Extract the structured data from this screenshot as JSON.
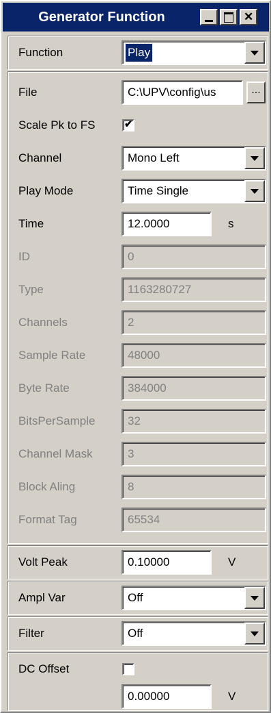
{
  "window": {
    "title": "Generator Function"
  },
  "function": {
    "label": "Function",
    "value": "Play"
  },
  "file": {
    "label": "File",
    "value": "C:\\UPV\\config\\us",
    "browse_label": "..."
  },
  "scale_pk": {
    "label": "Scale Pk to FS",
    "checked": true,
    "mark": "✔"
  },
  "channel": {
    "label": "Channel",
    "value": "Mono Left"
  },
  "play_mode": {
    "label": "Play Mode",
    "value": "Time Single"
  },
  "time": {
    "label": "Time",
    "value": "12.0000",
    "unit": "s"
  },
  "info": {
    "id": {
      "label": "ID",
      "value": "0"
    },
    "type": {
      "label": "Type",
      "value": "1163280727"
    },
    "channels": {
      "label": "Channels",
      "value": "2"
    },
    "sample_rate": {
      "label": "Sample Rate",
      "value": "48000"
    },
    "byte_rate": {
      "label": "Byte Rate",
      "value": "384000"
    },
    "bits_per_sample": {
      "label": "BitsPerSample",
      "value": "32"
    },
    "channel_mask": {
      "label": "Channel Mask",
      "value": "3"
    },
    "block_aling": {
      "label": "Block Aling",
      "value": "8"
    },
    "format_tag": {
      "label": "Format Tag",
      "value": "65534"
    }
  },
  "volt_peak": {
    "label": "Volt Peak",
    "value": "0.10000",
    "unit": "V"
  },
  "ampl_var": {
    "label": "Ampl Var",
    "value": "Off"
  },
  "filter": {
    "label": "Filter",
    "value": "Off"
  },
  "dc_offset": {
    "label": "DC Offset",
    "checked": false,
    "value": "0.00000",
    "unit": "V"
  },
  "colors": {
    "titlebar": "#0a246a",
    "panel": "#d4d0c8",
    "dim_text": "#808080"
  }
}
